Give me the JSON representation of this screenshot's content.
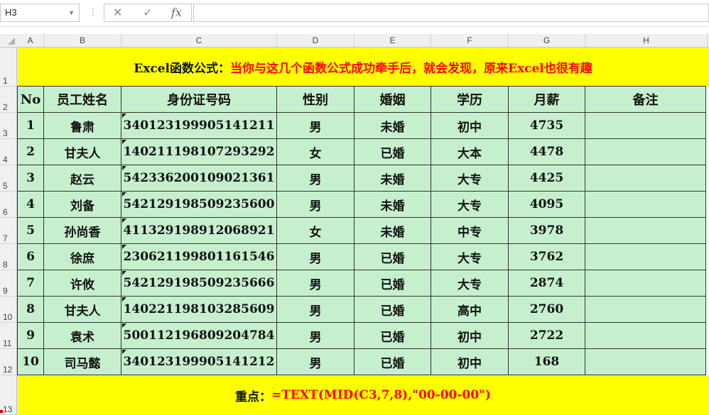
{
  "formula_bar": {
    "name_box": "H3",
    "cancel_icon": "✕",
    "enter_icon": "✓",
    "fx_label": "fx",
    "formula": ""
  },
  "columns": [
    "A",
    "B",
    "C",
    "D",
    "E",
    "F",
    "G",
    "H"
  ],
  "rows": [
    "1",
    "2",
    "3",
    "4",
    "5",
    "6",
    "7",
    "8",
    "9",
    "10",
    "11",
    "12",
    "13"
  ],
  "title": {
    "prefix": "Excel函数公式：",
    "text": "当你与这几个函数公式成功牵手后，就会发现，原来Excel也很有趣"
  },
  "table": {
    "headers": [
      "No",
      "员工姓名",
      "身份证号码",
      "性别",
      "婚姻",
      "学历",
      "月薪",
      "备注"
    ],
    "rows": [
      [
        "1",
        "鲁肃",
        "340123199905141211",
        "男",
        "未婚",
        "初中",
        "4735",
        ""
      ],
      [
        "2",
        "甘夫人",
        "140211198107293292",
        "女",
        "已婚",
        "大本",
        "4478",
        ""
      ],
      [
        "3",
        "赵云",
        "542336200109021361",
        "男",
        "未婚",
        "大专",
        "4425",
        ""
      ],
      [
        "4",
        "刘备",
        "542129198509235600",
        "男",
        "未婚",
        "大专",
        "4095",
        ""
      ],
      [
        "5",
        "孙尚香",
        "411329198912068921",
        "女",
        "未婚",
        "中专",
        "3978",
        ""
      ],
      [
        "6",
        "徐庶",
        "230621199801161546",
        "男",
        "已婚",
        "大专",
        "3762",
        ""
      ],
      [
        "7",
        "许攸",
        "542129198509235666",
        "男",
        "已婚",
        "大专",
        "2874",
        ""
      ],
      [
        "8",
        "甘夫人",
        "140221198103285609",
        "男",
        "已婚",
        "高中",
        "2760",
        ""
      ],
      [
        "9",
        "袁术",
        "500112196809204784",
        "男",
        "已婚",
        "初中",
        "2722",
        ""
      ],
      [
        "10",
        "司马懿",
        "340123199905141212",
        "男",
        "已婚",
        "初中",
        "168",
        ""
      ]
    ]
  },
  "note": {
    "prefix": "重点：",
    "formula": "=TEXT(MID(C3,7,8),\"00-00-00\")"
  },
  "colors": {
    "title_bg": "#ffff00",
    "title_accent": "#ff0000",
    "table_bg": "#c6efce",
    "grid_line": "#333333"
  }
}
